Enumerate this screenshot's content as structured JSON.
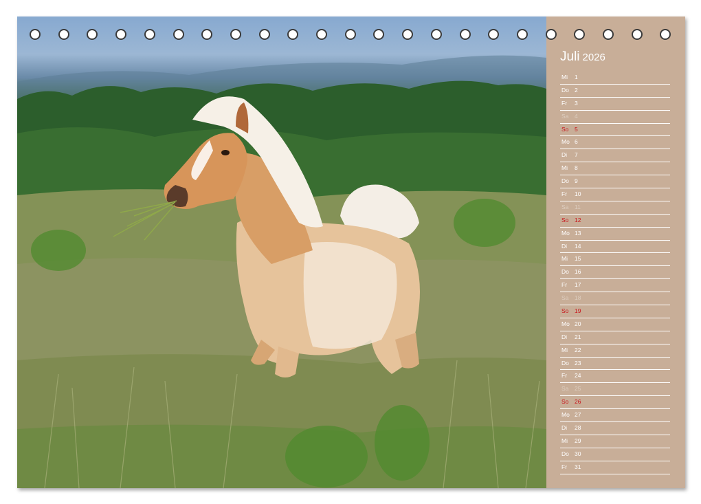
{
  "calendar": {
    "month": "Juli",
    "year": "2026",
    "photo_subject": "horse-foal-running-in-meadow",
    "colors": {
      "sidebar": "#c8ae98",
      "sunday": "#c8151b",
      "saturday": "#ddcdbf",
      "weekday": "#ffffff"
    },
    "days": [
      {
        "wd": "Mi",
        "d": "1",
        "type": "weekday"
      },
      {
        "wd": "Do",
        "d": "2",
        "type": "weekday"
      },
      {
        "wd": "Fr",
        "d": "3",
        "type": "weekday"
      },
      {
        "wd": "Sa",
        "d": "4",
        "type": "sat"
      },
      {
        "wd": "So",
        "d": "5",
        "type": "sun"
      },
      {
        "wd": "Mo",
        "d": "6",
        "type": "weekday"
      },
      {
        "wd": "Di",
        "d": "7",
        "type": "weekday"
      },
      {
        "wd": "Mi",
        "d": "8",
        "type": "weekday"
      },
      {
        "wd": "Do",
        "d": "9",
        "type": "weekday"
      },
      {
        "wd": "Fr",
        "d": "10",
        "type": "weekday"
      },
      {
        "wd": "Sa",
        "d": "11",
        "type": "sat"
      },
      {
        "wd": "So",
        "d": "12",
        "type": "sun"
      },
      {
        "wd": "Mo",
        "d": "13",
        "type": "weekday"
      },
      {
        "wd": "Di",
        "d": "14",
        "type": "weekday"
      },
      {
        "wd": "Mi",
        "d": "15",
        "type": "weekday"
      },
      {
        "wd": "Do",
        "d": "16",
        "type": "weekday"
      },
      {
        "wd": "Fr",
        "d": "17",
        "type": "weekday"
      },
      {
        "wd": "Sa",
        "d": "18",
        "type": "sat"
      },
      {
        "wd": "So",
        "d": "19",
        "type": "sun"
      },
      {
        "wd": "Mo",
        "d": "20",
        "type": "weekday"
      },
      {
        "wd": "Di",
        "d": "21",
        "type": "weekday"
      },
      {
        "wd": "Mi",
        "d": "22",
        "type": "weekday"
      },
      {
        "wd": "Do",
        "d": "23",
        "type": "weekday"
      },
      {
        "wd": "Fr",
        "d": "24",
        "type": "weekday"
      },
      {
        "wd": "Sa",
        "d": "25",
        "type": "sat"
      },
      {
        "wd": "So",
        "d": "26",
        "type": "sun"
      },
      {
        "wd": "Mo",
        "d": "27",
        "type": "weekday"
      },
      {
        "wd": "Di",
        "d": "28",
        "type": "weekday"
      },
      {
        "wd": "Mi",
        "d": "29",
        "type": "weekday"
      },
      {
        "wd": "Do",
        "d": "30",
        "type": "weekday"
      },
      {
        "wd": "Fr",
        "d": "31",
        "type": "weekday"
      }
    ]
  }
}
